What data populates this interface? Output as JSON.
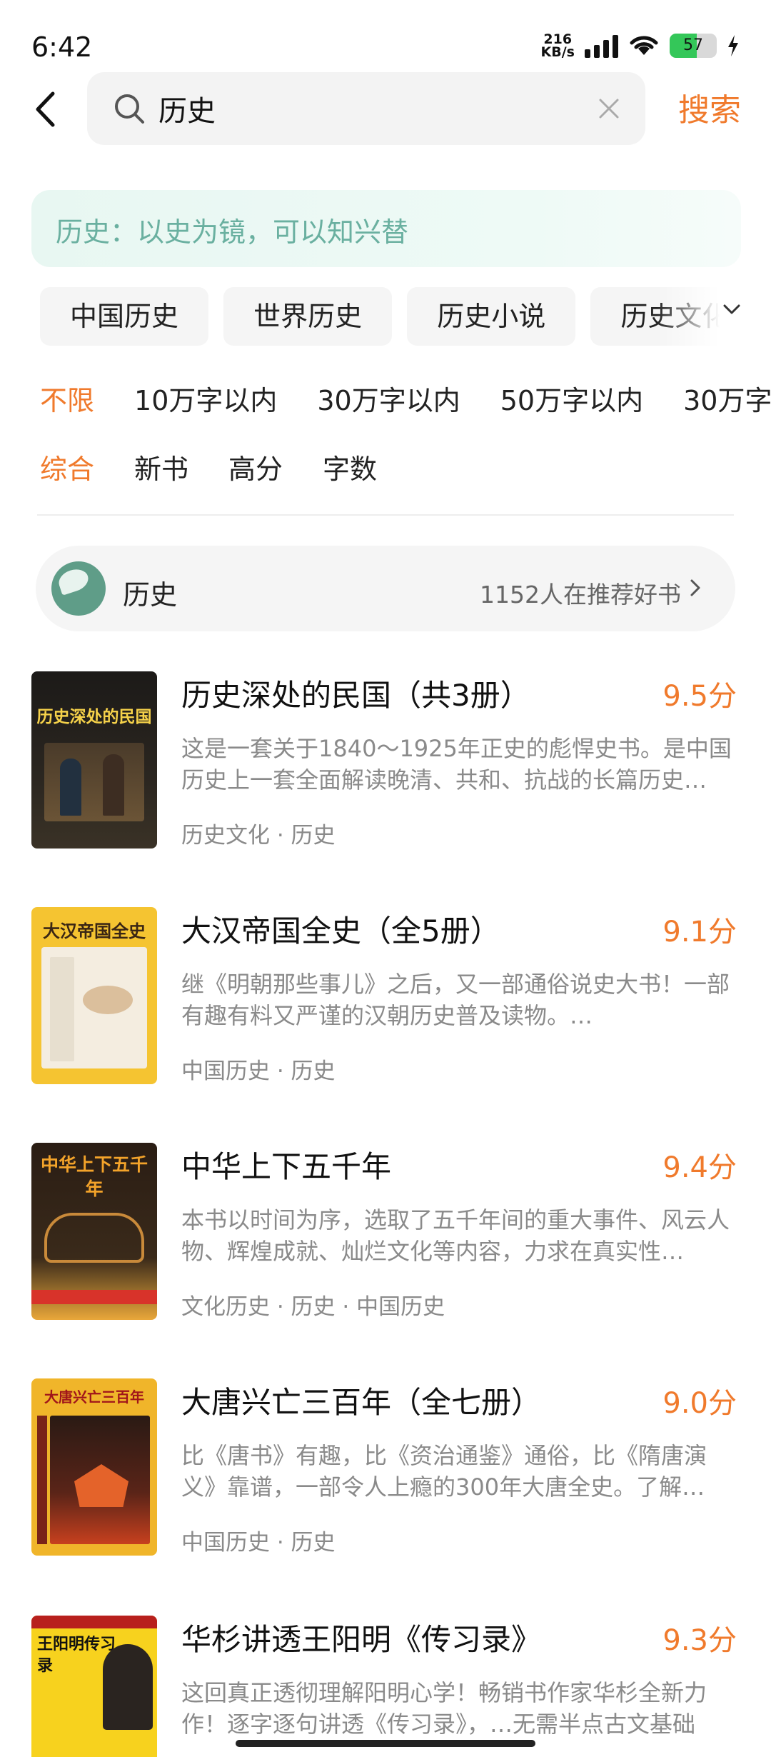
{
  "status_bar": {
    "time": "6:42",
    "net_speed_value": "216",
    "net_speed_unit": "KB/s",
    "battery_percent": "57",
    "battery_level": 0.57
  },
  "search": {
    "query": "历史",
    "submit_label": "搜索"
  },
  "banner": {
    "text": "历史：以史为镜，可以知兴替"
  },
  "categories": [
    "中国历史",
    "世界历史",
    "历史小说",
    "历史文化"
  ],
  "word_filters": [
    "不限",
    "10万字以内",
    "30万字以内",
    "50万字以内",
    "30万字"
  ],
  "sort_options": [
    "综合",
    "新书",
    "高分",
    "字数"
  ],
  "topic": {
    "name": "历史",
    "recommend_text": "1152人在推荐好书"
  },
  "books": [
    {
      "title": "历史深处的民国（共3册）",
      "score": "9.5分",
      "desc": "这是一套关于1840～1925年正史的彪悍史书。是中国历史上一套全面解读晚清、共和、抗战的长篇历史…",
      "tags": "历史文化 · 历史",
      "cover_text": "历史深处的民国"
    },
    {
      "title": "大汉帝国全史（全5册）",
      "score": "9.1分",
      "desc": "继《明朝那些事儿》之后，又一部通俗说史大书！一部有趣有料又严谨的汉朝历史普及读物。…",
      "tags": "中国历史 · 历史",
      "cover_text": "大汉帝国全史"
    },
    {
      "title": "中华上下五千年",
      "score": "9.4分",
      "desc": "本书以时间为序，选取了五千年间的重大事件、风云人物、辉煌成就、灿烂文化等内容，力求在真实性…",
      "tags": "文化历史 · 历史 · 中国历史",
      "cover_text": "中华上下五千年"
    },
    {
      "title": "大唐兴亡三百年（全七册）",
      "score": "9.0分",
      "desc": "比《唐书》有趣，比《资治通鉴》通俗，比《隋唐演义》靠谱，一部令人上瘾的300年大唐全史。了解…",
      "tags": "中国历史 · 历史",
      "cover_text": "大唐兴亡三百年"
    },
    {
      "title": "华杉讲透王阳明《传习录》",
      "score": "9.3分",
      "desc": "这回真正透彻理解阳明心学！畅销书作家华杉全新力作！逐字逐句讲透《传习录》，…无需半点古文基础",
      "tags": "",
      "cover_text": "王阳明传习录"
    }
  ]
}
